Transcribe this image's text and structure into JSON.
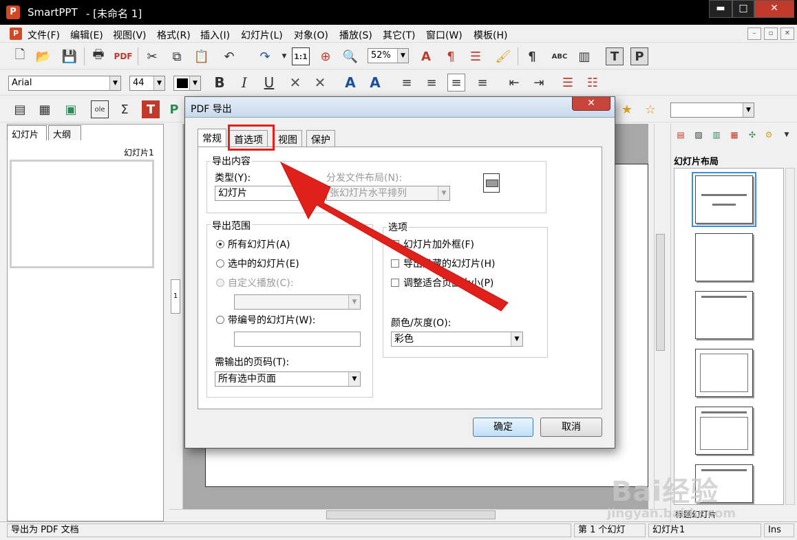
{
  "window": {
    "app_name": "SmartPPT",
    "doc_title": "- [未命名 1]",
    "controls": {
      "minimize": "▬",
      "maximize": "□",
      "close": "✕"
    }
  },
  "menu": [
    "文件(F)",
    "编辑(E)",
    "视图(V)",
    "格式(R)",
    "插入(I)",
    "幻灯片(L)",
    "对象(O)",
    "播放(S)",
    "其它(T)",
    "窗口(W)",
    "模板(H)"
  ],
  "toolbar": {
    "zoom": "52%",
    "font": "Arial",
    "font_size": "44",
    "bold": "B",
    "italic": "I",
    "underline": "U",
    "ratio": "1:1"
  },
  "left_panel": {
    "tabs": [
      "幻灯片",
      "大纲"
    ],
    "slide_label": "幻灯片1"
  },
  "right_panel": {
    "layout_title": "幻灯片布局",
    "footer_label": "标题幻灯片"
  },
  "ruler": {
    "marker": "1"
  },
  "statusbar": {
    "message": "导出为 PDF 文档",
    "slide_pos": "第 1 个幻灯",
    "slide_name": "幻灯片1",
    "mode": "Ins"
  },
  "dialog": {
    "title": "PDF 导出",
    "close": "✕",
    "tabs": [
      "常规",
      "首选项",
      "视图",
      "保护"
    ],
    "export_content": {
      "label": "导出内容",
      "type_label": "类型(Y):",
      "type_value": "幻灯片",
      "layout_label": "分发文件布局(N):",
      "layout_value": "张幻灯片水平排列"
    },
    "range": {
      "label": "导出范围",
      "all": "所有幻灯片(A)",
      "selected": "选中的幻灯片(E)",
      "custom": "自定义播放(C):",
      "numbered": "带编号的幻灯片(W):",
      "pages_label": "需输出的页码(T):",
      "pages_value": "所有选中页面"
    },
    "options": {
      "label": "选项",
      "frame": "幻灯片加外框(F)",
      "hidden": "导出隐藏的幻灯片(H)",
      "fit": "调整适合页面大小(P)",
      "color_label": "颜色/灰度(O):",
      "color_value": "彩色"
    },
    "buttons": {
      "ok": "确定",
      "cancel": "取消"
    }
  },
  "watermark": {
    "logo": "Bai经验",
    "url": "jingyan.baidu.com"
  },
  "colors": {
    "highlight": "#e0201b",
    "arrow": "#e0201b",
    "selection": "#3c8dde"
  },
  "icons": [
    "new-doc-icon",
    "open-folder-icon",
    "save-icon",
    "print-icon",
    "pdf-icon",
    "cut-icon",
    "copy-icon",
    "paste-icon",
    "undo-icon",
    "redo-icon",
    "zoom-icon",
    "text-color-icon",
    "paragraph-icon",
    "abc-spell-icon",
    "star-icon"
  ]
}
